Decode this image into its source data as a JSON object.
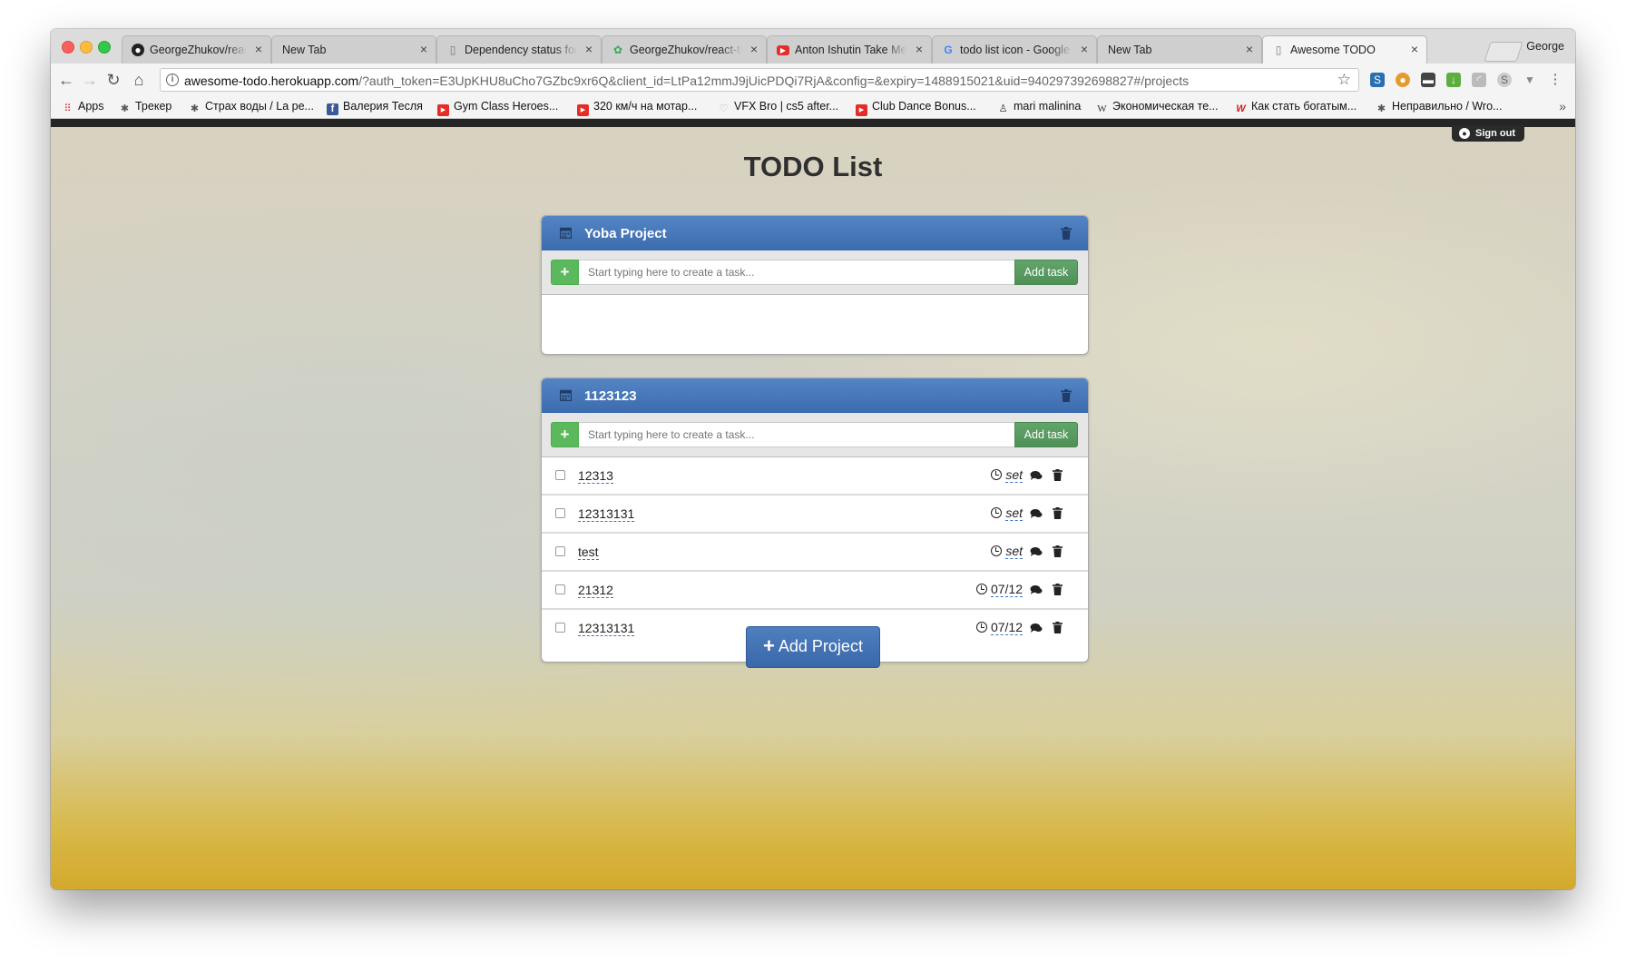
{
  "browser": {
    "tabs": [
      {
        "title": "GeorgeZhukov/react-to",
        "icon": "github-icon"
      },
      {
        "title": "New Tab",
        "icon": ""
      },
      {
        "title": "Dependency status for",
        "icon": "document-icon"
      },
      {
        "title": "GeorgeZhukov/react-to",
        "icon": "travis-icon"
      },
      {
        "title": "Anton Ishutin Take Me",
        "icon": "youtube-icon"
      },
      {
        "title": "todo list icon - Google",
        "icon": "google-icon"
      },
      {
        "title": "New Tab",
        "icon": ""
      },
      {
        "title": "Awesome TODO",
        "icon": "document-icon"
      }
    ],
    "profile_name": "George",
    "url_host": "awesome-todo.herokuapp.com",
    "url_rest": "/?auth_token=E3UpKHU8uCho7GZbc9xr6Q&client_id=LtPa12mmJ9jUicPDQi7RjA&config=&expiry=1488915021&uid=940297392698827#/projects",
    "bookmarks": [
      {
        "label": "Apps",
        "icon": "apps-grid-icon"
      },
      {
        "label": "Трекер",
        "icon": "tracker-icon"
      },
      {
        "label": "Страх воды / La pe...",
        "icon": "tracker-icon"
      },
      {
        "label": "Валерия Тесля",
        "icon": "facebook-icon"
      },
      {
        "label": "Gym Class Heroes...",
        "icon": "youtube-icon"
      },
      {
        "label": "320 км/ч на мотар...",
        "icon": "youtube-icon"
      },
      {
        "label": "VFX Bro | cs5 after...",
        "icon": "vimeo-icon"
      },
      {
        "label": "Club Dance Bonus...",
        "icon": "youtube-icon"
      },
      {
        "label": "mari malinina",
        "icon": "person-icon"
      },
      {
        "label": "Экономическая те...",
        "icon": "wikipedia-icon"
      },
      {
        "label": "Как стать богатым...",
        "icon": "w-red-icon"
      },
      {
        "label": "Неправильно / Wro...",
        "icon": "tracker-icon"
      }
    ],
    "bookmarks_more": "»"
  },
  "app": {
    "sign_out": "Sign out",
    "title": "TODO List",
    "add_task_placeholder": "Start typing here to create a task...",
    "add_task_label": "Add task",
    "add_task_plus": "+",
    "add_project_label": "Add Project",
    "add_project_plus": "+",
    "projects": [
      {
        "name": "Yoba Project",
        "tasks": []
      },
      {
        "name": "1123123",
        "tasks": [
          {
            "name": "12313",
            "deadline": "set",
            "has_date": false
          },
          {
            "name": "12313131",
            "deadline": "set",
            "has_date": false
          },
          {
            "name": "test",
            "deadline": "set",
            "has_date": false
          },
          {
            "name": "21312",
            "deadline": "07/12",
            "has_date": true
          },
          {
            "name": "12313131",
            "deadline": "07/12",
            "has_date": true
          }
        ]
      }
    ]
  },
  "colors": {
    "project_header": "#4a7abb",
    "success": "#5cb85c",
    "page_bottom": "#d4a92c"
  }
}
